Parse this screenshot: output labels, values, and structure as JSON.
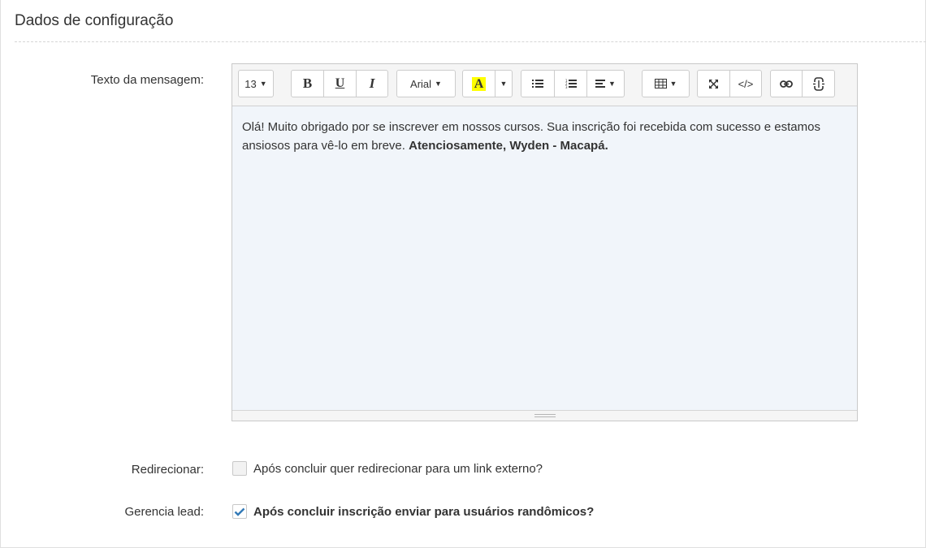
{
  "panel": {
    "title": "Dados de configuração"
  },
  "labels": {
    "message": "Texto da mensagem:",
    "redirect": "Redirecionar:",
    "lead": "Gerencia lead:"
  },
  "toolbar": {
    "font_size": "13",
    "bold": "B",
    "underline": "U",
    "italic": "I",
    "font_family": "Arial",
    "highlight_letter": "A",
    "code_view": "</>",
    "icons": [
      "bold",
      "underline",
      "italic",
      "highlight-color",
      "unordered-list",
      "ordered-list",
      "align",
      "table",
      "fullscreen",
      "code-view",
      "link",
      "unlink"
    ]
  },
  "editor": {
    "body_text": "Olá! Muito obrigado por se inscrever em nossos cursos. Sua inscrição foi recebida com sucesso e estamos ansiosos para vê-lo em breve.",
    "signature": "Atenciosamente, Wyden - Macapá."
  },
  "options": {
    "redirect_label": "Após concluir quer redirecionar para um link externo?",
    "redirect_checked": false,
    "lead_label": "Após concluir inscrição enviar para usuários randômicos?",
    "lead_checked": true
  },
  "colors": {
    "accent": "#337ab7",
    "editor_bg": "#f1f5fa",
    "highlight": "#ffff00"
  }
}
